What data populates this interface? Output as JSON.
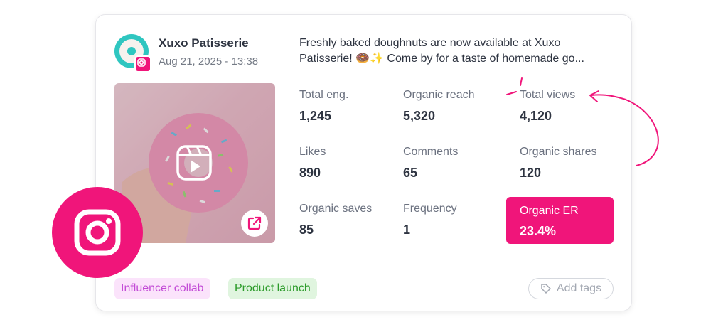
{
  "post": {
    "author": "Xuxo Patisserie",
    "date": "Aug 21, 2025 - 13:38",
    "caption_line1": "Freshly baked doughnuts are now available at Xuxo",
    "caption_line2": "Patisserie! 🍩✨ Come by for a taste of homemade go..."
  },
  "metrics": {
    "total_eng": {
      "label": "Total eng.",
      "value": "1,245"
    },
    "organic_reach": {
      "label": "Organic reach",
      "value": "5,320"
    },
    "total_views": {
      "label": "Total views",
      "value": "4,120"
    },
    "likes": {
      "label": "Likes",
      "value": "890"
    },
    "comments": {
      "label": "Comments",
      "value": "65"
    },
    "organic_shares": {
      "label": "Organic shares",
      "value": "120"
    },
    "organic_saves": {
      "label": "Organic saves",
      "value": "85"
    },
    "frequency": {
      "label": "Frequency",
      "value": "1"
    },
    "organic_er": {
      "label": "Organic ER",
      "value": "23.4%"
    }
  },
  "tags": [
    {
      "label": "Influencer collab",
      "color": "#c24bd6",
      "bg": "#fbe3fb"
    },
    {
      "label": "Product launch",
      "color": "#2c9b2a",
      "bg": "#e0f5df"
    }
  ],
  "add_tags_label": "Add tags",
  "icons": {
    "platform": "instagram-icon",
    "media_type": "reel-play-icon",
    "open": "external-link-icon",
    "tag": "tag-icon"
  },
  "colors": {
    "accent": "#f0157a",
    "avatar": "#2fc6c0",
    "text": "#2e3441",
    "muted": "#6c7280"
  }
}
